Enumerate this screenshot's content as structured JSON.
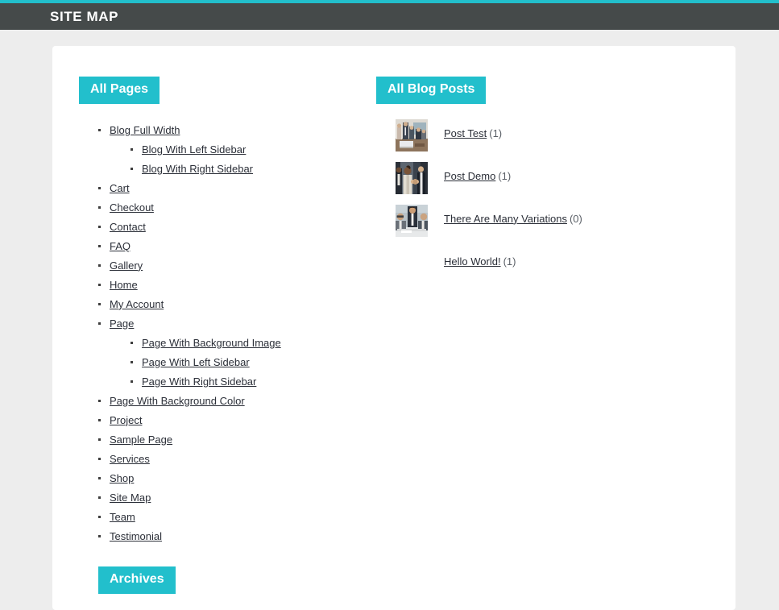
{
  "header": {
    "title": "Site Map",
    "accent_color": "#22bfcc",
    "bar_color": "#454a4a"
  },
  "sections": {
    "all_pages": {
      "badge": "All Pages"
    },
    "all_blog_posts": {
      "badge": "All Blog Posts"
    },
    "archives": {
      "badge": "Archives"
    }
  },
  "pages": [
    {
      "label": "Blog Full Width",
      "children": [
        {
          "label": "Blog With Left Sidebar"
        },
        {
          "label": "Blog With Right Sidebar"
        }
      ]
    },
    {
      "label": "Cart"
    },
    {
      "label": "Checkout"
    },
    {
      "label": "Contact"
    },
    {
      "label": "FAQ"
    },
    {
      "label": "Gallery"
    },
    {
      "label": "Home"
    },
    {
      "label": "My Account"
    },
    {
      "label": "Page",
      "children": [
        {
          "label": "Page With Background Image"
        },
        {
          "label": "Page With Left Sidebar"
        },
        {
          "label": "Page With Right Sidebar"
        }
      ]
    },
    {
      "label": "Page With Background Color"
    },
    {
      "label": "Project"
    },
    {
      "label": "Sample Page"
    },
    {
      "label": "Services"
    },
    {
      "label": "Shop"
    },
    {
      "label": "Site Map"
    },
    {
      "label": "Team"
    },
    {
      "label": "Testimonial"
    }
  ],
  "blog_posts": [
    {
      "title": "Post Test",
      "count": "(1)",
      "thumbnail": "business-meeting-photo"
    },
    {
      "title": "Post Demo",
      "count": "(1)",
      "thumbnail": "business-handshake-photo"
    },
    {
      "title": "There Are Many Variations",
      "count": "(0)",
      "thumbnail": "business-team-photo"
    },
    {
      "title": "Hello World!",
      "count": "(1)",
      "thumbnail": ""
    }
  ],
  "colors": {
    "accent": "#22bfcc",
    "header_bar": "#454a4a",
    "page_background": "#ededed",
    "card_background": "#ffffff",
    "link_text": "#2b2f38"
  }
}
